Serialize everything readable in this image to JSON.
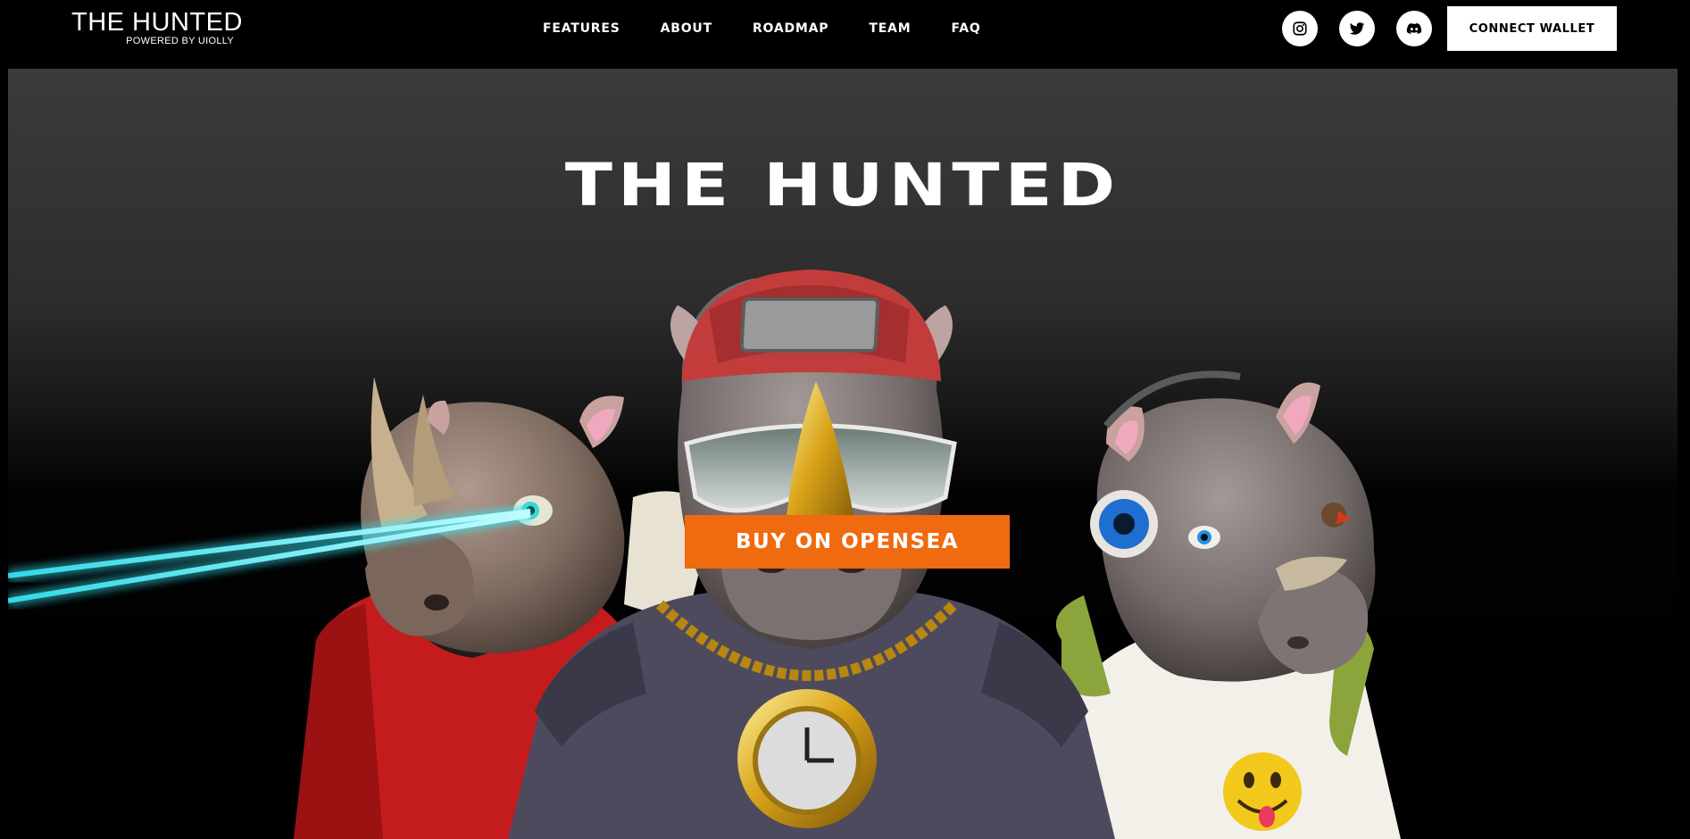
{
  "brand": {
    "title": "THE HUNTED",
    "subtitle": "POWERED BY UIOLLY"
  },
  "nav": {
    "items": [
      "FEATURES",
      "ABOUT",
      "ROADMAP",
      "TEAM",
      "FAQ"
    ]
  },
  "social": {
    "icons": [
      "instagram-icon",
      "twitter-icon",
      "discord-icon"
    ]
  },
  "header": {
    "connect_label": "CONNECT WALLET"
  },
  "hero": {
    "title": "THE HUNTED",
    "cta_label": "BUY ON OPENSEA"
  },
  "colors": {
    "accent": "#f06a0f",
    "background": "#000000",
    "laser": "#35e6f5"
  }
}
